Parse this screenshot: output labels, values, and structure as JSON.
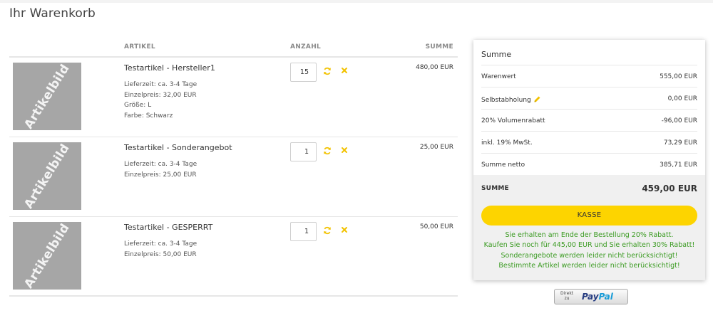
{
  "page": {
    "title": "Ihr Warenkorb"
  },
  "cart": {
    "headers": {
      "article": "ARTIKEL",
      "quantity": "ANZAHL",
      "total": "SUMME"
    },
    "placeholder_image_text": "Artikelbild",
    "items": [
      {
        "title": "Testartikel - Hersteller1",
        "meta": [
          "Lieferzeit: ca. 3-4 Tage",
          "Einzelpreis: 32,00 EUR",
          "Größe: L",
          "Farbe: Schwarz"
        ],
        "quantity": "15",
        "total": "480,00 EUR"
      },
      {
        "title": "Testartikel - Sonderangebot",
        "meta": [
          "Lieferzeit: ca. 3-4 Tage",
          "Einzelpreis: 25,00 EUR"
        ],
        "quantity": "1",
        "total": "25,00 EUR"
      },
      {
        "title": "Testartikel - GESPERRT",
        "meta": [
          "Lieferzeit: ca. 3-4 Tage",
          "Einzelpreis: 50,00 EUR"
        ],
        "quantity": "1",
        "total": "50,00 EUR"
      }
    ]
  },
  "summary": {
    "title": "Summe",
    "rows": [
      {
        "label": "Warenwert",
        "value": "555,00 EUR"
      },
      {
        "label": "Selbstabholung",
        "value": "0,00 EUR",
        "editable": true
      },
      {
        "label": "20% Volumenrabatt",
        "value": "-96,00 EUR"
      },
      {
        "label": "inkl. 19% MwSt.",
        "value": "73,29 EUR"
      },
      {
        "label": "Summe netto",
        "value": "385,71 EUR"
      }
    ],
    "total_label": "SUMME",
    "total_value": "459,00 EUR",
    "checkout_label": "KASSE",
    "notes": [
      "Sie erhalten am Ende der Bestellung 20% Rabatt.",
      "Kaufen Sie noch für 445,00 EUR und Sie erhalten 30% Rabatt!",
      "Sonderangebote werden leider nicht berücksichtigt!",
      "Bestimmte Artikel werden leider nicht berücksichtigt!"
    ]
  },
  "paypal": {
    "small_line1": "Direkt",
    "small_line2": "zu",
    "logo_part1": "Pay",
    "logo_part2": "Pal"
  },
  "colors": {
    "accent": "#fdd400",
    "notes_green": "#3b9b22",
    "icon_yellow": "#f2c200",
    "placeholder_gray": "#a6a6a6"
  },
  "icons": {
    "refresh": "refresh-icon",
    "remove": "close-icon",
    "edit": "pencil-icon"
  }
}
